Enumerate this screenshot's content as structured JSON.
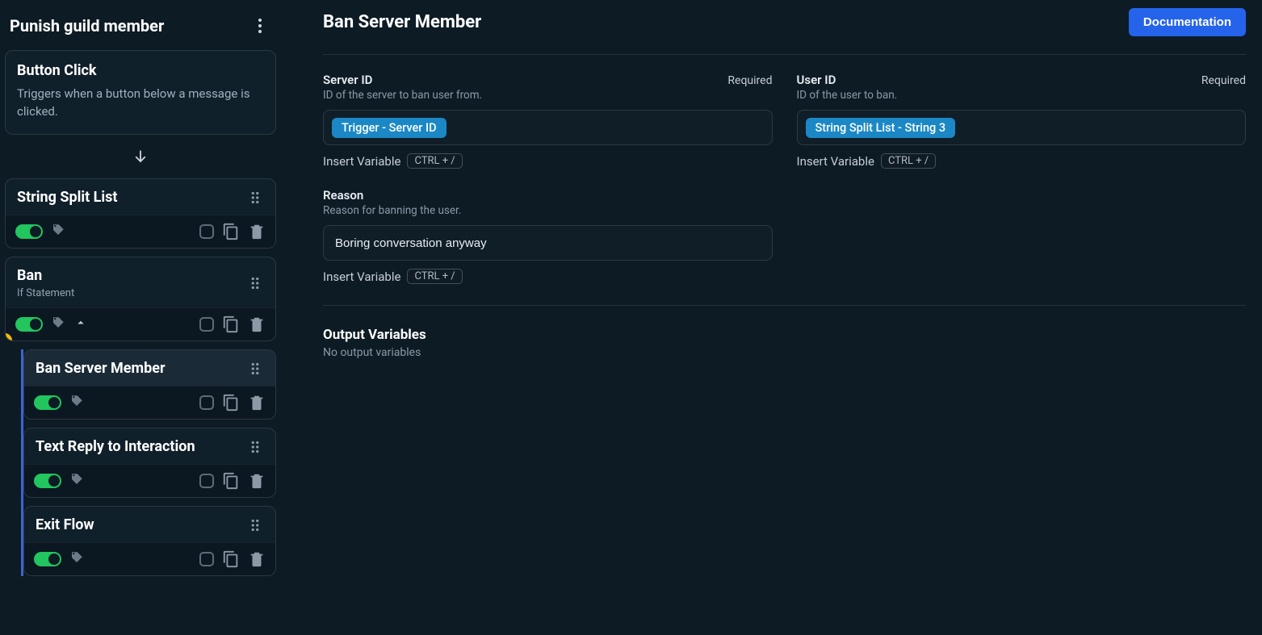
{
  "sidebar": {
    "title": "Punish guild member",
    "trigger": {
      "title": "Button Click",
      "description": "Triggers when a button below a message is clicked."
    },
    "blocks": [
      {
        "title": "String Split List",
        "subtitle": "",
        "hasCaret": false
      },
      {
        "title": "Ban",
        "subtitle": "If Statement",
        "hasCaret": true,
        "warn": "?"
      }
    ],
    "nestedBlocks": [
      {
        "title": "Ban Server Member",
        "selected": true
      },
      {
        "title": "Text Reply to Interaction"
      },
      {
        "title": "Exit Flow"
      }
    ]
  },
  "main": {
    "title": "Ban Server Member",
    "docButton": "Documentation",
    "fields": {
      "serverId": {
        "label": "Server ID",
        "desc": "ID of the server to ban user from.",
        "required": "Required",
        "chip": "Trigger - Server ID"
      },
      "userId": {
        "label": "User ID",
        "desc": "ID of the user to ban.",
        "required": "Required",
        "chip": "String Split List - String 3"
      },
      "reason": {
        "label": "Reason",
        "desc": "Reason for banning the user.",
        "value": "Boring conversation anyway"
      }
    },
    "insertVar": {
      "label": "Insert Variable",
      "kbd": "CTRL + /"
    },
    "output": {
      "title": "Output Variables",
      "desc": "No output variables"
    }
  }
}
